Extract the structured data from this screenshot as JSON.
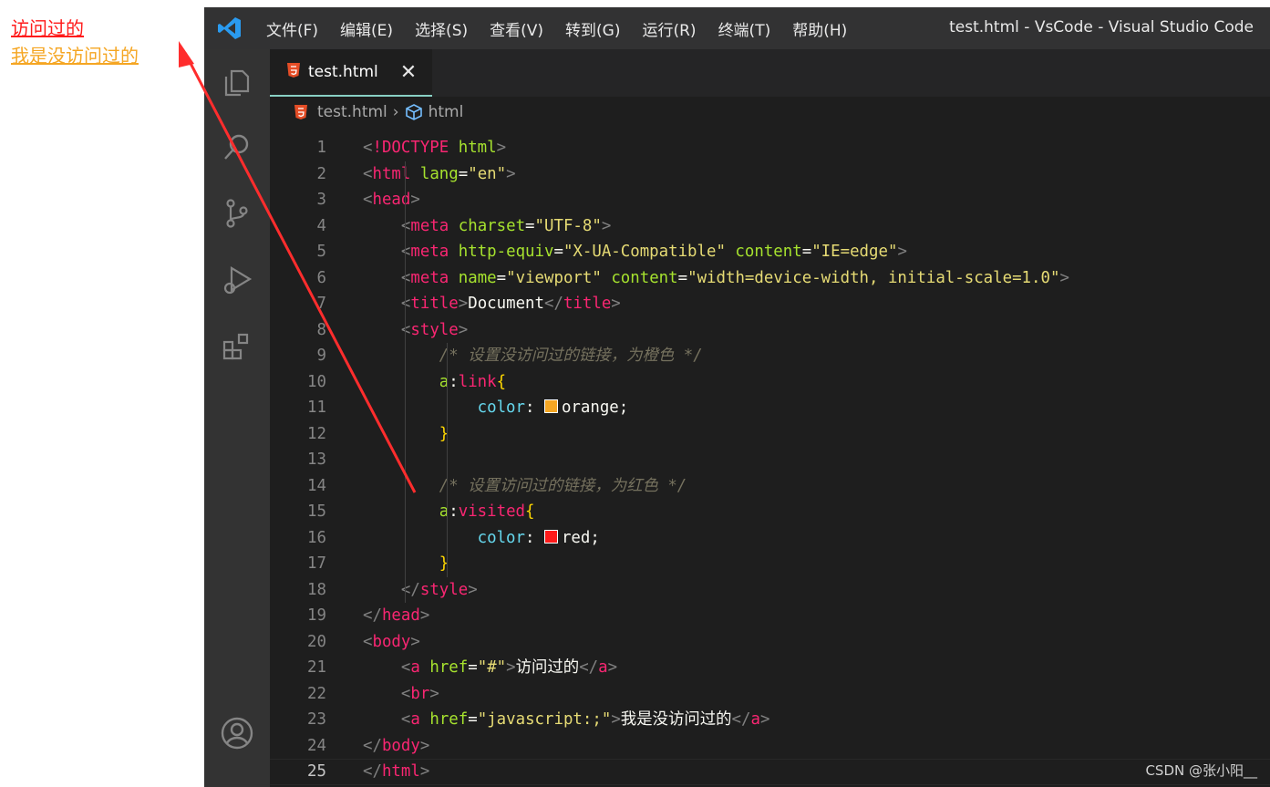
{
  "preview": {
    "visited_link": "访问过的",
    "unvisited_link": "我是没访问过的"
  },
  "titlebar": {
    "menu": [
      "文件(F)",
      "编辑(E)",
      "选择(S)",
      "查看(V)",
      "转到(G)",
      "运行(R)",
      "终端(T)",
      "帮助(H)"
    ],
    "title": "test.html - VsCode - Visual Studio Code"
  },
  "tab": {
    "label": "test.html",
    "close": "✕"
  },
  "breadcrumb": {
    "file": "test.html",
    "separator": "›",
    "node": "html"
  },
  "colors": {
    "orange_swatch": "#f5a623",
    "red_swatch": "#ff1a1a",
    "arrow": "#ff2d2d"
  },
  "code_lines": [
    "<!DOCTYPE html>",
    "<html lang=\"en\">",
    "<head>",
    "    <meta charset=\"UTF-8\">",
    "    <meta http-equiv=\"X-UA-Compatible\" content=\"IE=edge\">",
    "    <meta name=\"viewport\" content=\"width=device-width, initial-scale=1.0\">",
    "    <title>Document</title>",
    "    <style>",
    "        /* 设置没访问过的链接，为橙色 */",
    "        a:link{",
    "            color: orange;",
    "        }",
    "",
    "        /* 设置访问过的链接，为红色 */",
    "        a:visited{",
    "            color: red;",
    "        }",
    "    </style>",
    "</head>",
    "<body>",
    "    <a href=\"#\">访问过的</a>",
    "    <br>",
    "    <a href=\"javascript:;\">我是没访问过的</a>",
    "</body>",
    "</html>"
  ],
  "watermark": "CSDN @张小阳__"
}
